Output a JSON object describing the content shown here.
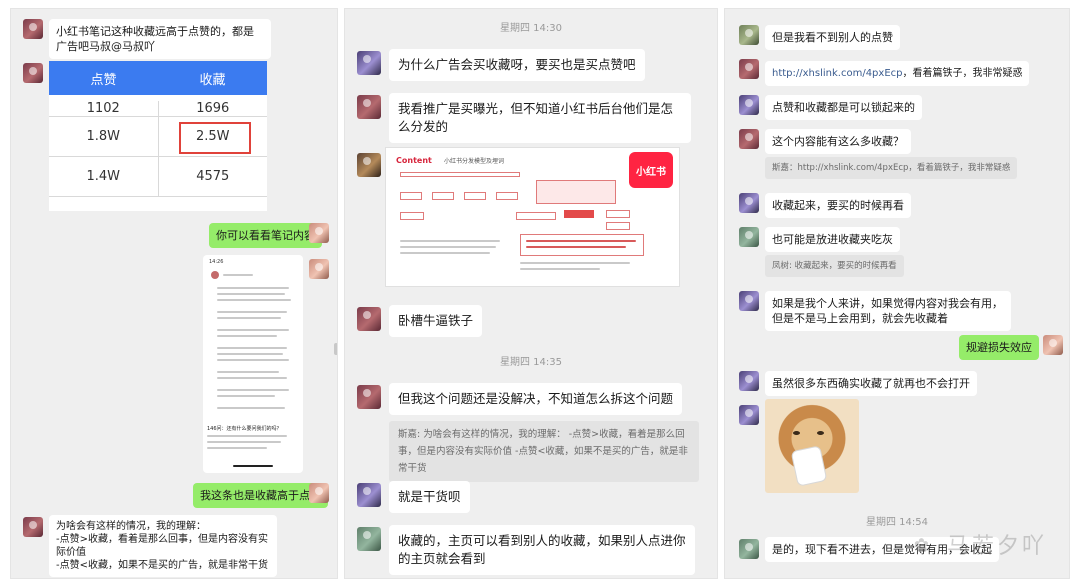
{
  "panel1": {
    "msg1": "小红书笔记这种收藏远高于点赞的，都是广告吧马叔@马叔吖",
    "table": {
      "headers": [
        "点赞",
        "收藏"
      ],
      "rows": [
        [
          "1102",
          "1696"
        ],
        [
          "1.8W",
          "2.5W"
        ],
        [
          "1.4W",
          "4575"
        ]
      ]
    },
    "msg_me1": "你可以看看笔记内容",
    "msg_me2": "我这条也是收藏高于点赞",
    "msg_last": "为啥会有这样的情况，我的理解：\n-点赞>收藏，看着是那么回事，但是内容没有实际价值\n-点赞<收藏，如果不是买的广告，就是非常干货",
    "phone": {
      "time": "14:26",
      "footer": "146问：还有什么要问我们的吗？"
    }
  },
  "panel2": {
    "time1": "星期四 14:30",
    "msg1": "为什么广告会买收藏呀，要买也是买点赞吧",
    "msg2": "我看推广是买曝光，但不知道小红书后台他们是怎么分发的",
    "slide": {
      "title": "Content",
      "subtitle": "小红书分发模型及埋词",
      "logo": "小红书"
    },
    "msg3": "卧槽牛逼铁子",
    "time2": "星期四 14:35",
    "msg4": "但我这个问题还是没解决，不知道怎么拆这个问题",
    "quote4": "斯嘉: 为啥会有这样的情况，我的理解： -点赞>收藏，看着是那么回事，但是内容没有实际价值 -点赞<收藏，如果不是买的广告，就是非常干货",
    "msg5": "就是干货呗",
    "msg6": "收藏的，主页可以看到别人的收藏，如果别人点进你的主页就会看到"
  },
  "panel3": {
    "msg1": "但是我看不到别人的点赞",
    "msg2_link": "http://xhslink.com/4pxEcp",
    "msg2_rest": "，看着篇铁子，我非常疑惑",
    "msg3": "点赞和收藏都是可以锁起来的",
    "msg4": "这个内容能有这么多收藏？",
    "quote4": "斯嘉：http://xhslink.com/4pxEcp，看着篇铁子，我非常疑惑",
    "msg5": "收藏起来，要买的时候再看",
    "msg6": "也可能是放进收藏夹吃灰",
    "quote6": "凤树: 收藏起来，要买的时候再看",
    "msg7": "如果是我个人来讲，如果觉得内容对我会有用，但是不是马上会用到，就会先收藏着",
    "msg_me": "规避损失效应",
    "msg8": "虽然很多东西确实收藏了就再也不会打开",
    "time": "星期四 14:54",
    "msg9": "是的，现下看不进去，但是觉得有用，会收起",
    "watermark": "马若夕吖"
  },
  "colors": {
    "me_bubble": "#95ec69",
    "highlight": "#e0423a",
    "table_header": "#3b7bf0",
    "xhs_red": "#ff2442"
  }
}
